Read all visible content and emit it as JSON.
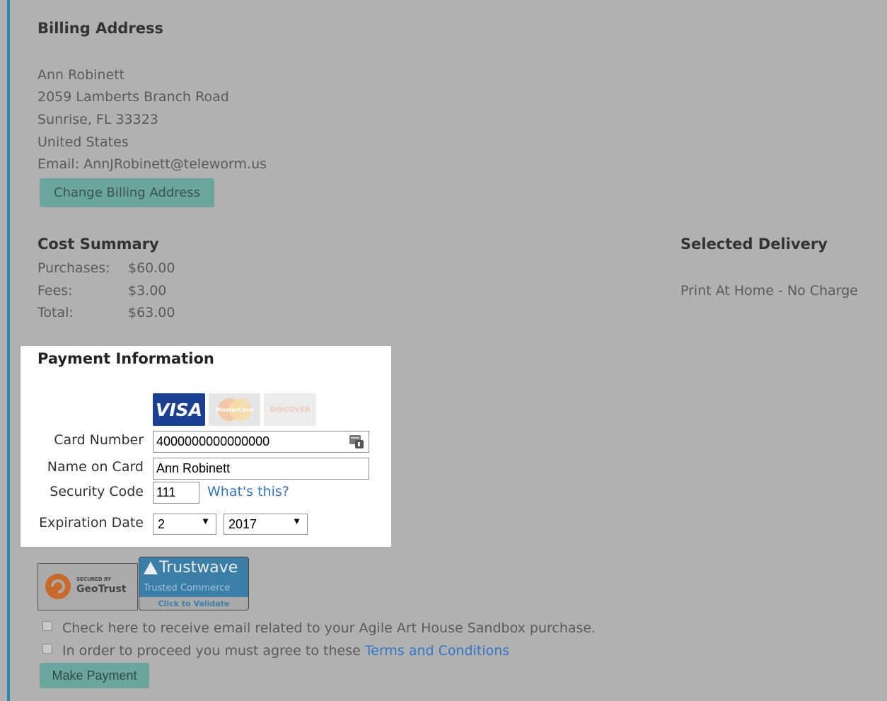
{
  "billing": {
    "heading": "Billing Address",
    "name": "Ann Robinett",
    "street": "2059 Lamberts Branch Road",
    "city_line": "Sunrise, FL 33323",
    "country": "United States",
    "email": "Email: AnnJRobinett@teleworm.us",
    "change_button": "Change Billing Address"
  },
  "cost_summary": {
    "heading": "Cost Summary",
    "rows": [
      {
        "label": "Purchases:",
        "value": "$60.00"
      },
      {
        "label": "Fees:",
        "value": "$3.00"
      },
      {
        "label": "Total:",
        "value": "$63.00"
      }
    ]
  },
  "delivery": {
    "heading": "Selected Delivery",
    "method": "Print At Home - No Charge"
  },
  "payment": {
    "heading": "Payment Information",
    "card_logos": [
      "VISA",
      "MasterCard",
      "DISCOVER"
    ],
    "card_number_label": "Card Number",
    "card_number_value": "4000000000000000",
    "name_label": "Name on Card",
    "name_value": "Ann Robinett",
    "security_label": "Security Code",
    "security_value": "111",
    "whats_this": "What's this?",
    "expiration_label": "Expiration Date",
    "exp_month": "2",
    "exp_year": "2017"
  },
  "seals": {
    "geotrust_small": "SECURED BY",
    "geotrust_brand": "GeoTrust",
    "trustwave_brand": "Trustwave",
    "trustwave_sub": "Trusted Commerce",
    "trustwave_validate": "Click to Validate"
  },
  "checkboxes": {
    "email_opt": "Check here to receive email related to your Agile Art House Sandbox purchase.",
    "terms_prefix": "In order to proceed you must agree to these",
    "terms_link": "Terms and Conditions"
  },
  "make_payment_button": "Make Payment"
}
